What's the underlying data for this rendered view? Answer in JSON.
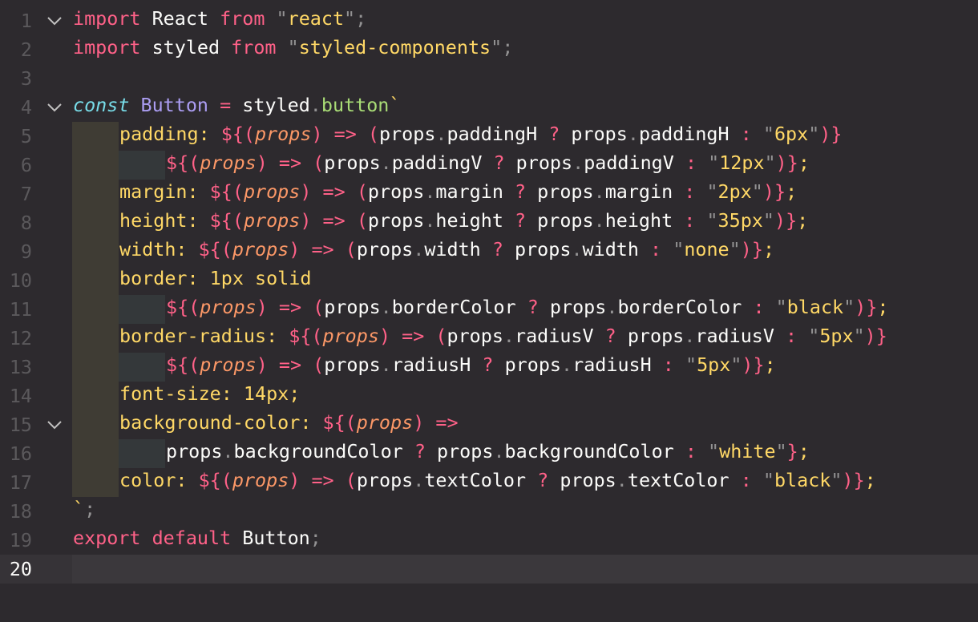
{
  "editor": {
    "language": "javascript",
    "colors": {
      "background": "#2d2a2e",
      "keyword": "#ff6188",
      "string": "#ffd866",
      "type": "#ab9df2",
      "storage": "#78dce8",
      "function": "#a9dc76",
      "parameter": "#fc9867",
      "text": "#fcfcfa",
      "punctuation": "#939293"
    },
    "current_line": 20,
    "folded_lines_with_chevron": [
      1,
      4,
      15
    ],
    "fold_icon": "chevron-down-icon",
    "lines": [
      {
        "n": "1",
        "guide": 0,
        "tokens": [
          [
            "kw",
            "import"
          ],
          [
            "plain",
            " React "
          ],
          [
            "kw",
            "from"
          ],
          [
            "plain",
            " "
          ],
          [
            "quote",
            "\""
          ],
          [
            "str",
            "react"
          ],
          [
            "quote",
            "\""
          ],
          [
            "punct",
            ";"
          ]
        ]
      },
      {
        "n": "2",
        "guide": 0,
        "tokens": [
          [
            "kw",
            "import"
          ],
          [
            "plain",
            " styled "
          ],
          [
            "kw",
            "from"
          ],
          [
            "plain",
            " "
          ],
          [
            "quote",
            "\""
          ],
          [
            "str",
            "styled-components"
          ],
          [
            "quote",
            "\""
          ],
          [
            "punct",
            ";"
          ]
        ]
      },
      {
        "n": "3",
        "guide": 0,
        "tokens": []
      },
      {
        "n": "4",
        "guide": 0,
        "tokens": [
          [
            "storage",
            "const"
          ],
          [
            "plain",
            " "
          ],
          [
            "type",
            "Button"
          ],
          [
            "plain",
            " "
          ],
          [
            "kw",
            "="
          ],
          [
            "plain",
            " styled"
          ],
          [
            "dot",
            "."
          ],
          [
            "func",
            "button"
          ],
          [
            "str",
            "`"
          ]
        ]
      },
      {
        "n": "5",
        "guide": 1,
        "tokens": [
          [
            "prop",
            "padding"
          ],
          [
            "prop",
            ": "
          ],
          [
            "kw",
            "${"
          ],
          [
            "tok-paren",
            "("
          ],
          [
            "param",
            "props"
          ],
          [
            "tok-paren",
            ")"
          ],
          [
            "plain",
            " "
          ],
          [
            "kw",
            "=>"
          ],
          [
            "plain",
            " "
          ],
          [
            "tok-paren",
            "("
          ],
          [
            "plain",
            "props"
          ],
          [
            "dot",
            "."
          ],
          [
            "plain",
            "paddingH "
          ],
          [
            "kw",
            "?"
          ],
          [
            "plain",
            " props"
          ],
          [
            "dot",
            "."
          ],
          [
            "plain",
            "paddingH "
          ],
          [
            "kw",
            ":"
          ],
          [
            "plain",
            " "
          ],
          [
            "quote",
            "\""
          ],
          [
            "str",
            "6px"
          ],
          [
            "quote",
            "\""
          ],
          [
            "tok-paren",
            ")"
          ],
          [
            "kw",
            "}"
          ]
        ]
      },
      {
        "n": "6",
        "guide": 2,
        "tokens": [
          [
            "kw",
            "${"
          ],
          [
            "tok-paren",
            "("
          ],
          [
            "param",
            "props"
          ],
          [
            "tok-paren",
            ")"
          ],
          [
            "plain",
            " "
          ],
          [
            "kw",
            "=>"
          ],
          [
            "plain",
            " "
          ],
          [
            "tok-paren",
            "("
          ],
          [
            "plain",
            "props"
          ],
          [
            "dot",
            "."
          ],
          [
            "plain",
            "paddingV "
          ],
          [
            "kw",
            "?"
          ],
          [
            "plain",
            " props"
          ],
          [
            "dot",
            "."
          ],
          [
            "plain",
            "paddingV "
          ],
          [
            "kw",
            ":"
          ],
          [
            "plain",
            " "
          ],
          [
            "quote",
            "\""
          ],
          [
            "str",
            "12px"
          ],
          [
            "quote",
            "\""
          ],
          [
            "tok-paren",
            ")"
          ],
          [
            "kw",
            "}"
          ],
          [
            "prop",
            ";"
          ]
        ]
      },
      {
        "n": "7",
        "guide": 1,
        "tokens": [
          [
            "prop",
            "margin"
          ],
          [
            "prop",
            ": "
          ],
          [
            "kw",
            "${"
          ],
          [
            "tok-paren",
            "("
          ],
          [
            "param",
            "props"
          ],
          [
            "tok-paren",
            ")"
          ],
          [
            "plain",
            " "
          ],
          [
            "kw",
            "=>"
          ],
          [
            "plain",
            " "
          ],
          [
            "tok-paren",
            "("
          ],
          [
            "plain",
            "props"
          ],
          [
            "dot",
            "."
          ],
          [
            "plain",
            "margin "
          ],
          [
            "kw",
            "?"
          ],
          [
            "plain",
            " props"
          ],
          [
            "dot",
            "."
          ],
          [
            "plain",
            "margin "
          ],
          [
            "kw",
            ":"
          ],
          [
            "plain",
            " "
          ],
          [
            "quote",
            "\""
          ],
          [
            "str",
            "2px"
          ],
          [
            "quote",
            "\""
          ],
          [
            "tok-paren",
            ")"
          ],
          [
            "kw",
            "}"
          ],
          [
            "prop",
            ";"
          ]
        ]
      },
      {
        "n": "8",
        "guide": 1,
        "tokens": [
          [
            "prop",
            "height"
          ],
          [
            "prop",
            ": "
          ],
          [
            "kw",
            "${"
          ],
          [
            "tok-paren",
            "("
          ],
          [
            "param",
            "props"
          ],
          [
            "tok-paren",
            ")"
          ],
          [
            "plain",
            " "
          ],
          [
            "kw",
            "=>"
          ],
          [
            "plain",
            " "
          ],
          [
            "tok-paren",
            "("
          ],
          [
            "plain",
            "props"
          ],
          [
            "dot",
            "."
          ],
          [
            "plain",
            "height "
          ],
          [
            "kw",
            "?"
          ],
          [
            "plain",
            " props"
          ],
          [
            "dot",
            "."
          ],
          [
            "plain",
            "height "
          ],
          [
            "kw",
            ":"
          ],
          [
            "plain",
            " "
          ],
          [
            "quote",
            "\""
          ],
          [
            "str",
            "35px"
          ],
          [
            "quote",
            "\""
          ],
          [
            "tok-paren",
            ")"
          ],
          [
            "kw",
            "}"
          ],
          [
            "prop",
            ";"
          ]
        ]
      },
      {
        "n": "9",
        "guide": 1,
        "tokens": [
          [
            "prop",
            "width"
          ],
          [
            "prop",
            ": "
          ],
          [
            "kw",
            "${"
          ],
          [
            "tok-paren",
            "("
          ],
          [
            "param",
            "props"
          ],
          [
            "tok-paren",
            ")"
          ],
          [
            "plain",
            " "
          ],
          [
            "kw",
            "=>"
          ],
          [
            "plain",
            " "
          ],
          [
            "tok-paren",
            "("
          ],
          [
            "plain",
            "props"
          ],
          [
            "dot",
            "."
          ],
          [
            "plain",
            "width "
          ],
          [
            "kw",
            "?"
          ],
          [
            "plain",
            " props"
          ],
          [
            "dot",
            "."
          ],
          [
            "plain",
            "width "
          ],
          [
            "kw",
            ":"
          ],
          [
            "plain",
            " "
          ],
          [
            "quote",
            "\""
          ],
          [
            "str",
            "none"
          ],
          [
            "quote",
            "\""
          ],
          [
            "tok-paren",
            ")"
          ],
          [
            "kw",
            "}"
          ],
          [
            "prop",
            ";"
          ]
        ]
      },
      {
        "n": "10",
        "guide": 1,
        "tokens": [
          [
            "prop",
            "border: 1px solid"
          ]
        ]
      },
      {
        "n": "11",
        "guide": 2,
        "tokens": [
          [
            "kw",
            "${"
          ],
          [
            "tok-paren",
            "("
          ],
          [
            "param",
            "props"
          ],
          [
            "tok-paren",
            ")"
          ],
          [
            "plain",
            " "
          ],
          [
            "kw",
            "=>"
          ],
          [
            "plain",
            " "
          ],
          [
            "tok-paren",
            "("
          ],
          [
            "plain",
            "props"
          ],
          [
            "dot",
            "."
          ],
          [
            "plain",
            "borderColor "
          ],
          [
            "kw",
            "?"
          ],
          [
            "plain",
            " props"
          ],
          [
            "dot",
            "."
          ],
          [
            "plain",
            "borderColor "
          ],
          [
            "kw",
            ":"
          ],
          [
            "plain",
            " "
          ],
          [
            "quote",
            "\""
          ],
          [
            "str",
            "black"
          ],
          [
            "quote",
            "\""
          ],
          [
            "tok-paren",
            ")"
          ],
          [
            "kw",
            "}"
          ],
          [
            "prop",
            ";"
          ]
        ]
      },
      {
        "n": "12",
        "guide": 1,
        "tokens": [
          [
            "prop",
            "border-radius"
          ],
          [
            "prop",
            ": "
          ],
          [
            "kw",
            "${"
          ],
          [
            "tok-paren",
            "("
          ],
          [
            "param",
            "props"
          ],
          [
            "tok-paren",
            ")"
          ],
          [
            "plain",
            " "
          ],
          [
            "kw",
            "=>"
          ],
          [
            "plain",
            " "
          ],
          [
            "tok-paren",
            "("
          ],
          [
            "plain",
            "props"
          ],
          [
            "dot",
            "."
          ],
          [
            "plain",
            "radiusV "
          ],
          [
            "kw",
            "?"
          ],
          [
            "plain",
            " props"
          ],
          [
            "dot",
            "."
          ],
          [
            "plain",
            "radiusV "
          ],
          [
            "kw",
            ":"
          ],
          [
            "plain",
            " "
          ],
          [
            "quote",
            "\""
          ],
          [
            "str",
            "5px"
          ],
          [
            "quote",
            "\""
          ],
          [
            "tok-paren",
            ")"
          ],
          [
            "kw",
            "}"
          ]
        ]
      },
      {
        "n": "13",
        "guide": 2,
        "tokens": [
          [
            "kw",
            "${"
          ],
          [
            "tok-paren",
            "("
          ],
          [
            "param",
            "props"
          ],
          [
            "tok-paren",
            ")"
          ],
          [
            "plain",
            " "
          ],
          [
            "kw",
            "=>"
          ],
          [
            "plain",
            " "
          ],
          [
            "tok-paren",
            "("
          ],
          [
            "plain",
            "props"
          ],
          [
            "dot",
            "."
          ],
          [
            "plain",
            "radiusH "
          ],
          [
            "kw",
            "?"
          ],
          [
            "plain",
            " props"
          ],
          [
            "dot",
            "."
          ],
          [
            "plain",
            "radiusH "
          ],
          [
            "kw",
            ":"
          ],
          [
            "plain",
            " "
          ],
          [
            "quote",
            "\""
          ],
          [
            "str",
            "5px"
          ],
          [
            "quote",
            "\""
          ],
          [
            "tok-paren",
            ")"
          ],
          [
            "kw",
            "}"
          ],
          [
            "prop",
            ";"
          ]
        ]
      },
      {
        "n": "14",
        "guide": 1,
        "tokens": [
          [
            "prop",
            "font-size: 14px;"
          ]
        ]
      },
      {
        "n": "15",
        "guide": 1,
        "tokens": [
          [
            "prop",
            "background-color"
          ],
          [
            "prop",
            ": "
          ],
          [
            "kw",
            "${"
          ],
          [
            "tok-paren",
            "("
          ],
          [
            "param",
            "props"
          ],
          [
            "tok-paren",
            ")"
          ],
          [
            "plain",
            " "
          ],
          [
            "kw",
            "=>"
          ]
        ]
      },
      {
        "n": "16",
        "guide": 2,
        "tokens": [
          [
            "plain",
            "props"
          ],
          [
            "dot",
            "."
          ],
          [
            "plain",
            "backgroundColor "
          ],
          [
            "kw",
            "?"
          ],
          [
            "plain",
            " props"
          ],
          [
            "dot",
            "."
          ],
          [
            "plain",
            "backgroundColor "
          ],
          [
            "kw",
            ":"
          ],
          [
            "plain",
            " "
          ],
          [
            "quote",
            "\""
          ],
          [
            "str",
            "white"
          ],
          [
            "quote",
            "\""
          ],
          [
            "kw",
            "}"
          ],
          [
            "prop",
            ";"
          ]
        ]
      },
      {
        "n": "17",
        "guide": 1,
        "tokens": [
          [
            "prop",
            "color"
          ],
          [
            "prop",
            ": "
          ],
          [
            "kw",
            "${"
          ],
          [
            "tok-paren",
            "("
          ],
          [
            "param",
            "props"
          ],
          [
            "tok-paren",
            ")"
          ],
          [
            "plain",
            " "
          ],
          [
            "kw",
            "=>"
          ],
          [
            "plain",
            " "
          ],
          [
            "tok-paren",
            "("
          ],
          [
            "plain",
            "props"
          ],
          [
            "dot",
            "."
          ],
          [
            "plain",
            "textColor "
          ],
          [
            "kw",
            "?"
          ],
          [
            "plain",
            " props"
          ],
          [
            "dot",
            "."
          ],
          [
            "plain",
            "textColor "
          ],
          [
            "kw",
            ":"
          ],
          [
            "plain",
            " "
          ],
          [
            "quote",
            "\""
          ],
          [
            "str",
            "black"
          ],
          [
            "quote",
            "\""
          ],
          [
            "tok-paren",
            ")"
          ],
          [
            "kw",
            "}"
          ],
          [
            "prop",
            ";"
          ]
        ]
      },
      {
        "n": "18",
        "guide": 0,
        "tokens": [
          [
            "str",
            "`"
          ],
          [
            "punct",
            ";"
          ]
        ]
      },
      {
        "n": "19",
        "guide": 0,
        "tokens": [
          [
            "kw",
            "export"
          ],
          [
            "plain",
            " "
          ],
          [
            "kw",
            "default"
          ],
          [
            "plain",
            " Button"
          ],
          [
            "punct",
            ";"
          ]
        ]
      },
      {
        "n": "20",
        "guide": 0,
        "tokens": []
      }
    ]
  }
}
